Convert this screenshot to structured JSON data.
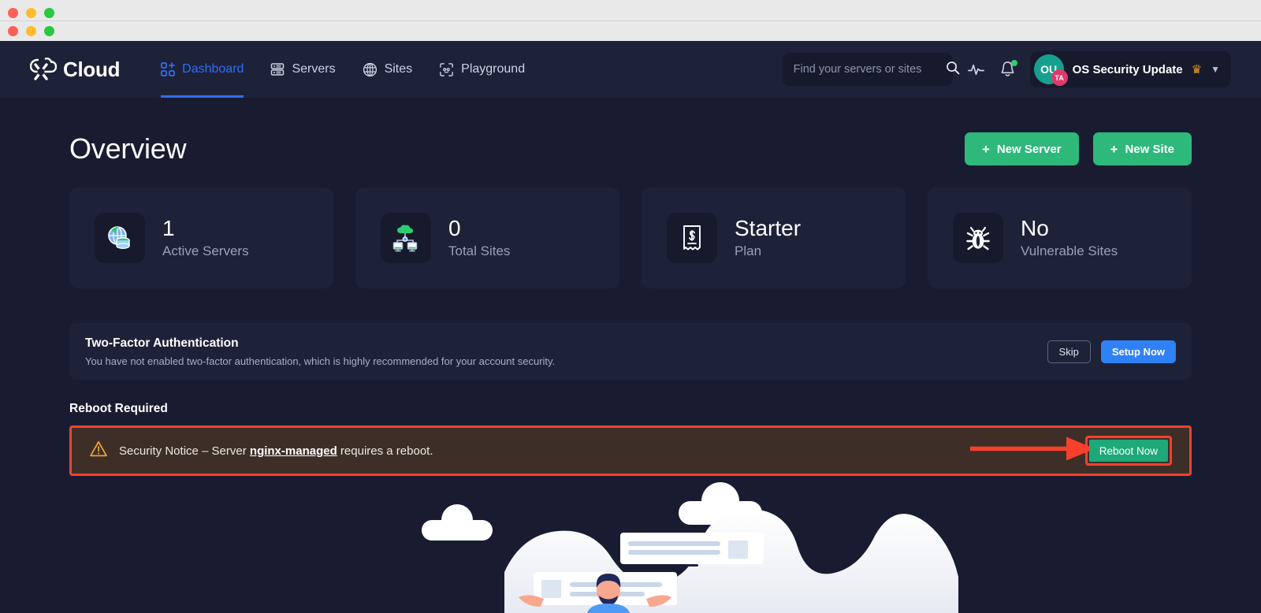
{
  "window": {
    "traffic_lights": [
      "red",
      "yellow",
      "green"
    ]
  },
  "brand": {
    "name": "Cloud",
    "logo_icon": "cloud-x-logo-icon"
  },
  "nav": {
    "items": [
      {
        "label": "Dashboard",
        "icon": "grid-plus-icon",
        "active": true
      },
      {
        "label": "Servers",
        "icon": "server-rack-icon",
        "active": false
      },
      {
        "label": "Sites",
        "icon": "globe-icon",
        "active": false
      },
      {
        "label": "Playground",
        "icon": "playground-icon",
        "active": false
      }
    ]
  },
  "search": {
    "placeholder": "Find your servers or sites",
    "value": "",
    "icon": "search-icon"
  },
  "header_icons": {
    "activity": "activity-pulse-icon",
    "notifications": "bell-icon",
    "notification_dot": true
  },
  "user": {
    "avatar_initials": "OU",
    "avatar_badge": "TA",
    "name": "OS Security Update",
    "crown_icon": "crown-icon",
    "chevron_icon": "chevron-down-icon"
  },
  "page": {
    "title": "Overview",
    "actions": [
      {
        "label": "New Server",
        "icon": "plus-icon"
      },
      {
        "label": "New Site",
        "icon": "plus-icon"
      }
    ]
  },
  "stats": [
    {
      "value": "1",
      "label": "Active Servers",
      "icon": "globe-database-icon"
    },
    {
      "value": "0",
      "label": "Total Sites",
      "icon": "cloud-network-icon"
    },
    {
      "value": "Starter",
      "label": "Plan",
      "icon": "receipt-dollar-icon"
    },
    {
      "value": "No",
      "label": "Vulnerable Sites",
      "icon": "bug-icon"
    }
  ],
  "two_factor": {
    "title": "Two-Factor Authentication",
    "description": "You have not enabled two-factor authentication, which is highly recommended for your account security.",
    "skip_label": "Skip",
    "setup_label": "Setup Now"
  },
  "reboot": {
    "heading": "Reboot Required",
    "warn_icon": "warning-triangle-icon",
    "message_prefix": "Security Notice – Server ",
    "message_server": "nginx-managed",
    "message_suffix": " requires a reboot.",
    "button_label": "Reboot Now"
  },
  "annotation": {
    "highlight_color": "#f9402c",
    "arrow_icon": "right-arrow-annotation-icon"
  },
  "colors": {
    "page_background": "#191c31",
    "card_background": "#1e2238",
    "nav_background": "#1e2238",
    "accent_blue": "#2f6df6",
    "accent_green": "#2eb87a",
    "button_blue": "#2f81f7",
    "alert_background": "#3d2f28",
    "alert_border": "#f9402c",
    "avatar_teal": "#17a08f",
    "badge_pink": "#dc3a6a",
    "crown_orange": "#e8961e"
  }
}
